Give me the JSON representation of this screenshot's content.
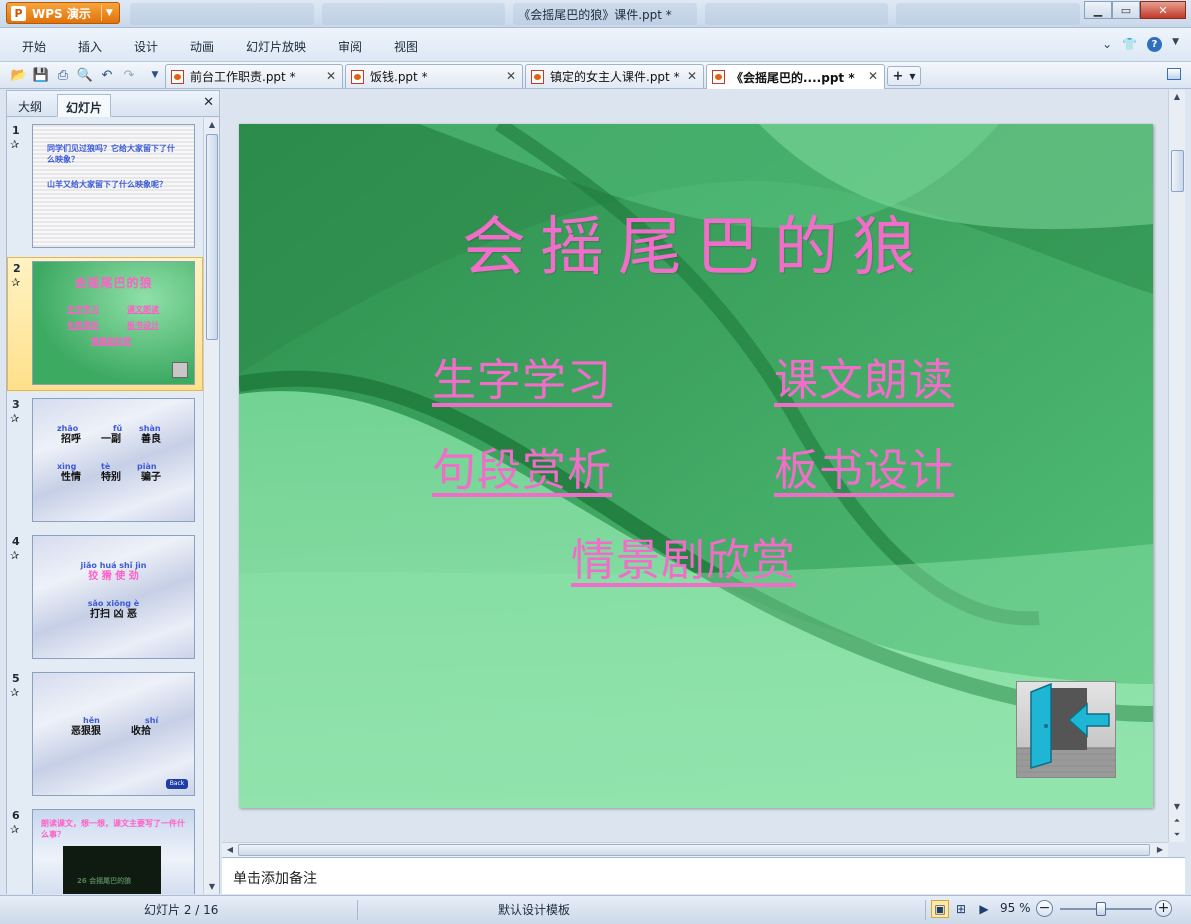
{
  "titlebar": {
    "app_name": "WPS 演示",
    "app_logo_letter": "P",
    "window_title": "《会摇尾巴的狼》课件.ppt *"
  },
  "menu": {
    "items": [
      "开始",
      "插入",
      "设计",
      "动画",
      "幻灯片放映",
      "审阅",
      "视图"
    ]
  },
  "doc_tabs": [
    {
      "label": "前台工作职责.ppt *",
      "active": false
    },
    {
      "label": "饭钱.ppt *",
      "active": false
    },
    {
      "label": "镇定的女主人课件.ppt *",
      "active": false
    },
    {
      "label": "《会摇尾巴的....ppt *",
      "active": true
    }
  ],
  "left_panel": {
    "tabs": [
      "大纲",
      "幻灯片"
    ],
    "active_tab": "幻灯片",
    "thumbnails": [
      {
        "num": "1",
        "lines": [
          "同学们见过狼吗？它给大家留下了什么映象？",
          "山羊又给大家留下了什么映象呢？"
        ]
      },
      {
        "num": "2",
        "title": "会摇尾巴的狼",
        "links": [
          "生字学习",
          "课文朗读",
          "句段赏析",
          "板书设计",
          "情景剧欣赏"
        ]
      },
      {
        "num": "3",
        "pinyin_row1": [
          "zhāo",
          "fǔ",
          "shàn"
        ],
        "chars_row1": [
          "招呼",
          "一副",
          "善良"
        ],
        "pinyin_row2": [
          "xìng",
          "tè",
          "piàn"
        ],
        "chars_row2": [
          "性情",
          "特别",
          "骗子"
        ]
      },
      {
        "num": "4",
        "pinyin_row1": "jiǎo huá   shǐ  jìn",
        "chars_row1": "狡  猾  使  劲",
        "pinyin_row2": "sǎo  xiōng  è",
        "chars_row2": "打扫  凶  恶"
      },
      {
        "num": "5",
        "pinyin": [
          "hěn",
          "shí"
        ],
        "chars": [
          "恶狠狠",
          "收拾"
        ],
        "back_label": "Back"
      },
      {
        "num": "6",
        "lines": [
          "朗读课文，想一想，课文主要写了一件什么事？"
        ],
        "caption": "26 会摇尾巴的狼"
      }
    ]
  },
  "slide": {
    "title": "会摇尾巴的狼",
    "links": [
      "生字学习",
      "课文朗读",
      "句段赏析",
      "板书设计",
      "情景剧欣赏"
    ],
    "accent": "#f26cc9"
  },
  "notes": {
    "placeholder": "单击添加备注"
  },
  "status": {
    "slide_indicator": "幻灯片 2 / 16",
    "template": "默认设计模板",
    "zoom": "95 %"
  }
}
